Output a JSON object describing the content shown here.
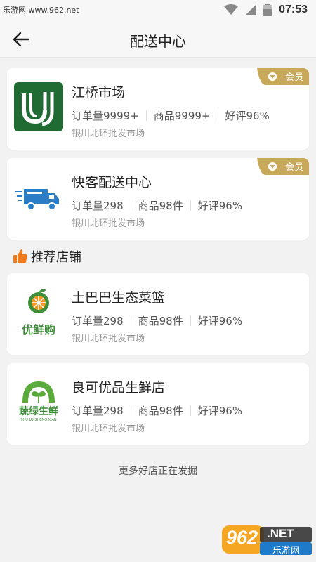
{
  "watermark_top": "乐游网 www.962.net",
  "status_bar": {
    "time": "07:53"
  },
  "nav": {
    "title": "配送中心"
  },
  "badge_label": "会员",
  "members": [
    {
      "name": "江桥市场",
      "orders": "订单量9999+",
      "goods": "商品9999+",
      "rating": "好评96%",
      "address": "银川北环批发市场"
    },
    {
      "name": "快客配送中心",
      "orders": "订单量298",
      "goods": "商品98件",
      "rating": "好评96%",
      "address": "银川北环批发市场"
    }
  ],
  "recommend": {
    "title": "推荐店铺"
  },
  "stores": [
    {
      "name": "土巴巴生态菜篮",
      "logo_text": "优鲜购",
      "orders": "订单量298",
      "goods": "商品98件",
      "rating": "好评96%",
      "address": "银川北环批发市场"
    },
    {
      "name": "良可优品生鲜店",
      "logo_text": "蔬绿生鲜",
      "logo_subtext": "SHU LU SHENG XIAN",
      "orders": "订单量298",
      "goods": "商品98件",
      "rating": "好评96%",
      "address": "银川北环批发市场"
    }
  ],
  "footer": {
    "text": "更多好店正在发掘"
  },
  "watermark_bottom": {
    "number": "962",
    "suffix": ".NET",
    "text": "乐游网"
  },
  "colors": {
    "gold": "#c8a95a",
    "green": "#3e8e3a",
    "thumb": "#f07b1c"
  }
}
